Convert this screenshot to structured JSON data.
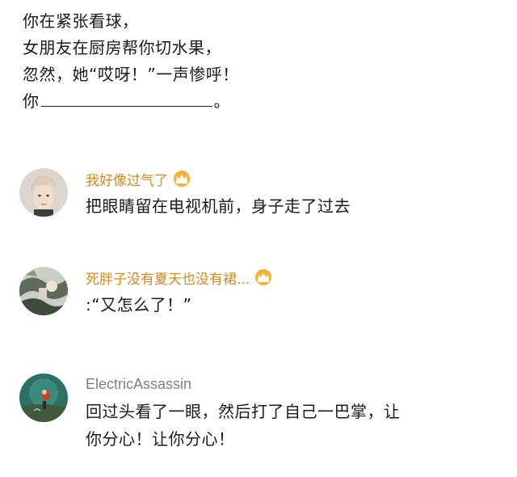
{
  "post": {
    "lines": [
      "你在紧张看球，",
      "女朋友在厨房帮你切水果，",
      "忽然，她“哎呀！”一声惨呼！"
    ],
    "prompt_prefix": "你",
    "prompt_suffix": "。"
  },
  "comments": [
    {
      "username": "我好像过气了",
      "badge_icon": "crown-badge-icon",
      "text": "把眼睛留在电视机前，身子走了过去"
    },
    {
      "username": "死胖子没有夏天也没有裙...",
      "badge_icon": "crown-badge-icon",
      "text": ":“又怎么了！”"
    },
    {
      "username": "ElectricAssassin",
      "text_lines": [
        "回过头看了一眼，然后打了自己一巴掌，让",
        "你分心！让你分心！"
      ]
    }
  ],
  "colors": {
    "vip_username": "#d4891e",
    "plain_username": "#7f7f7f",
    "crown": "#f0a020",
    "text": "#1a1a1a"
  }
}
